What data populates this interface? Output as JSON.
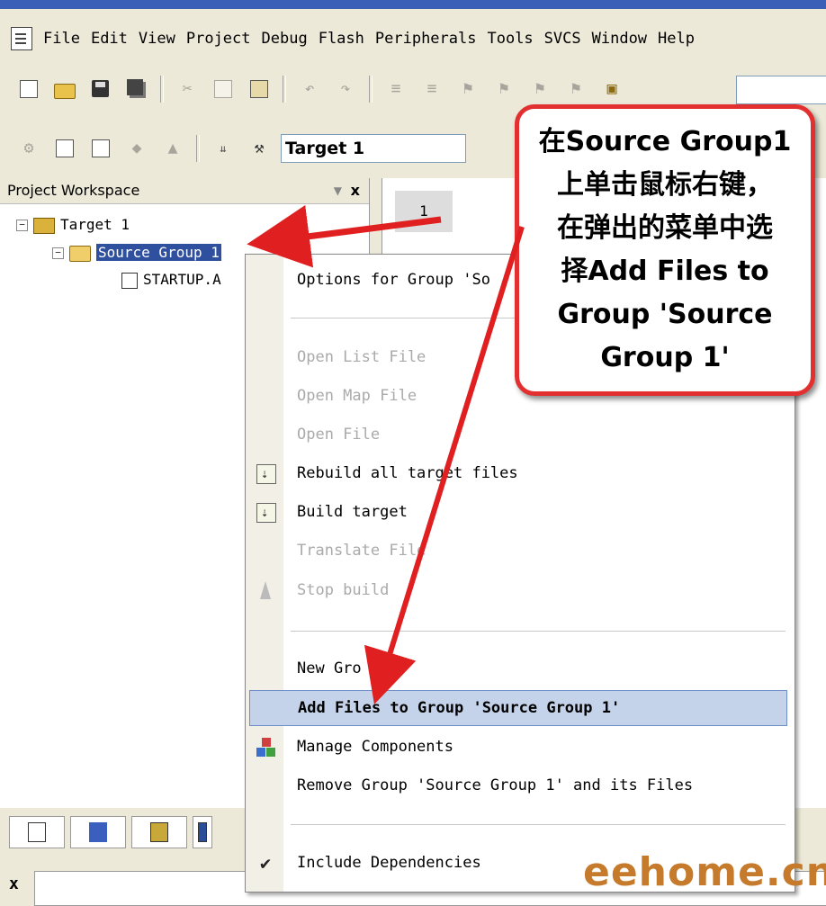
{
  "menubar": {
    "items": [
      "File",
      "Edit",
      "View",
      "Project",
      "Debug",
      "Flash",
      "Peripherals",
      "Tools",
      "SVCS",
      "Window",
      "Help"
    ]
  },
  "toolbar2": {
    "target": "Target 1"
  },
  "workspace": {
    "title": "Project Workspace",
    "close": "x",
    "tree": {
      "target": "Target 1",
      "group": "Source Group 1",
      "file": "STARTUP.A"
    }
  },
  "editor": {
    "line_number": "1"
  },
  "context_menu": {
    "items": [
      "Options for Group 'So",
      "Open List File",
      "Open Map File",
      "Open File",
      "Rebuild all target files",
      "Build target",
      "Translate File",
      "Stop build",
      "New Gro",
      "Add Files to Group 'Source Group 1'",
      "Manage Components",
      "Remove Group 'Source Group 1' and its Files",
      "Include Dependencies"
    ]
  },
  "callout": {
    "text": "在Source Group1\n上单击鼠标右键，\n在弹出的菜单中选\n择Add Files to\nGroup 'Source\nGroup 1'",
    "border_color": "#e23030",
    "arrow_color": "#e02020"
  },
  "bottom": {
    "close": "x"
  },
  "watermark": "eehome.cn"
}
